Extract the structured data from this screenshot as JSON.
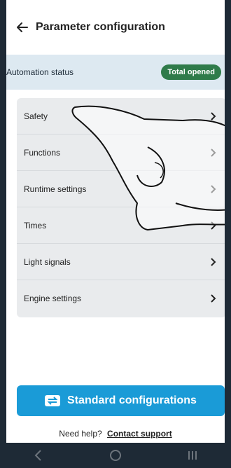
{
  "header": {
    "title": "Parameter configuration",
    "back_icon": "arrow-left-icon"
  },
  "status": {
    "label": "Automation status",
    "badge": "Total opened",
    "badge_color": "#2f7b4a"
  },
  "menu": {
    "items": [
      {
        "label": "Safety",
        "icon": "chevron-right-icon"
      },
      {
        "label": "Functions",
        "icon": "chevron-right-icon"
      },
      {
        "label": "Runtime settings",
        "icon": "chevron-right-icon"
      },
      {
        "label": "Times",
        "icon": "chevron-right-icon"
      },
      {
        "label": "Light signals",
        "icon": "chevron-right-icon"
      },
      {
        "label": "Engine settings",
        "icon": "chevron-right-icon"
      }
    ]
  },
  "actions": {
    "standard_label": "Standard configurations",
    "standard_icon": "swap-icon",
    "accent": "#1a9bd7"
  },
  "help": {
    "text": "Need help?",
    "link": "Contact support"
  },
  "navbar": {
    "icons": [
      "back-nav-icon",
      "home-nav-icon",
      "recents-nav-icon"
    ]
  }
}
